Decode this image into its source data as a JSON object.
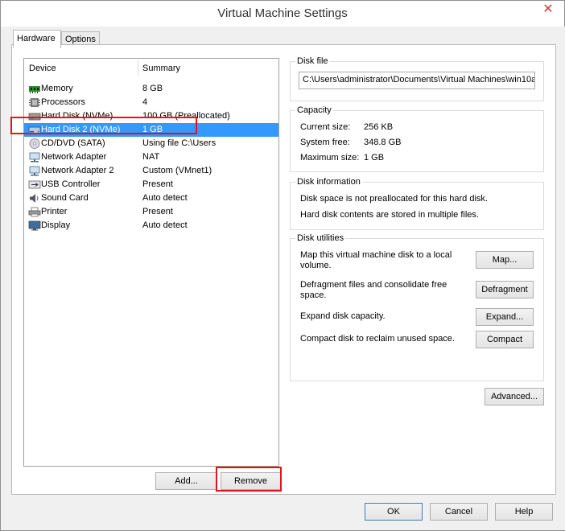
{
  "window": {
    "title": "Virtual Machine Settings"
  },
  "tabs": [
    {
      "label": "Hardware"
    },
    {
      "label": "Options"
    }
  ],
  "device_list": {
    "columns": {
      "device": "Device",
      "summary": "Summary"
    },
    "rows": [
      {
        "icon": "memory-icon",
        "device": "Memory",
        "summary": "8 GB"
      },
      {
        "icon": "processor-icon",
        "device": "Processors",
        "summary": "4"
      },
      {
        "icon": "hard-disk-icon",
        "device": "Hard Disk (NVMe)",
        "summary": "100 GB (Preallocated)"
      },
      {
        "icon": "hard-disk-icon",
        "device": "Hard Disk 2 (NVMe)",
        "summary": "1 GB",
        "selected": true
      },
      {
        "icon": "cd-dvd-icon",
        "device": "CD/DVD (SATA)",
        "summary": "Using file C:\\Users"
      },
      {
        "icon": "network-adapter-icon",
        "device": "Network Adapter",
        "summary": "NAT"
      },
      {
        "icon": "network-adapter-icon",
        "device": "Network Adapter 2",
        "summary": "Custom (VMnet1)"
      },
      {
        "icon": "usb-icon",
        "device": "USB Controller",
        "summary": "Present"
      },
      {
        "icon": "sound-card-icon",
        "device": "Sound Card",
        "summary": "Auto detect"
      },
      {
        "icon": "printer-icon",
        "device": "Printer",
        "summary": "Present"
      },
      {
        "icon": "display-icon",
        "device": "Display",
        "summary": "Auto detect"
      }
    ],
    "add_label": "Add...",
    "remove_label": "Remove"
  },
  "disk_file": {
    "title": "Disk file",
    "path": "C:\\Users\\administrator\\Documents\\Virtual Machines\\win10a"
  },
  "capacity": {
    "title": "Capacity",
    "current_label": "Current size:",
    "current_value": "256 KB",
    "free_label": "System free:",
    "free_value": "348.8 GB",
    "max_label": "Maximum size:",
    "max_value": "1 GB"
  },
  "disk_info": {
    "title": "Disk information",
    "line1": "Disk space is not preallocated for this hard disk.",
    "line2": "Hard disk contents are stored in multiple files."
  },
  "disk_utilities": {
    "title": "Disk utilities",
    "map_text_1": "Map this virtual machine disk to a local",
    "map_text_2": "volume.",
    "map_button": "Map...",
    "defrag_text_1": "Defragment files and consolidate free",
    "defrag_text_2": "space.",
    "defrag_button": "Defragment",
    "expand_text": "Expand disk capacity.",
    "expand_button": "Expand...",
    "compact_text": "Compact disk to reclaim unused space.",
    "compact_button": "Compact"
  },
  "advanced_button": "Advanced...",
  "footer": {
    "ok": "OK",
    "cancel": "Cancel",
    "help": "Help"
  },
  "colors": {
    "selection": "#3399ff",
    "highlight_box": "#e0141e",
    "close": "#d03a2e"
  }
}
